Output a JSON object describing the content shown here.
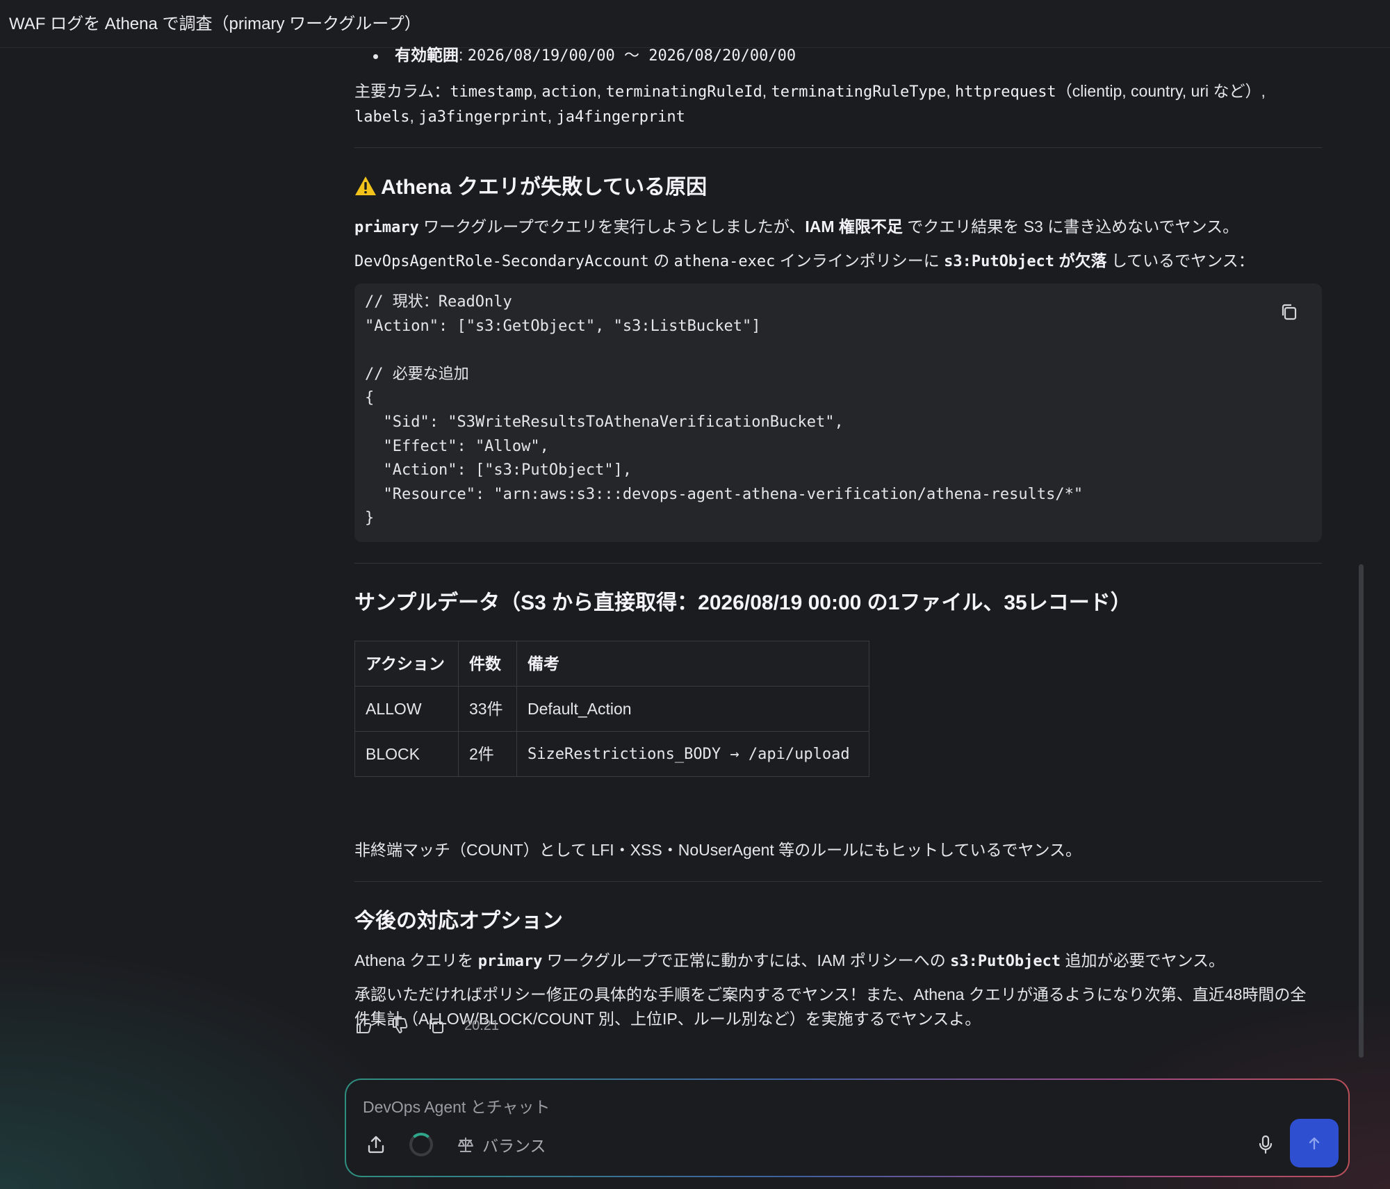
{
  "header": {
    "title": "WAF ログを Athena で調査（primary ワークグループ）"
  },
  "message": {
    "validity_label": "有効範囲",
    "validity_value": "2026/08/19/00/00 〜 2026/08/20/00/00",
    "columns_prefix": "主要カラム：",
    "columns": {
      "c1": "timestamp",
      "c2": "action",
      "c3": "terminatingRuleId",
      "c4": "terminatingRuleType",
      "c5": "httprequest",
      "c5_note": "（clientip, country, uri など）",
      "c6": "labels",
      "c7": "ja3fingerprint",
      "c8": "ja4fingerprint"
    },
    "cause": {
      "heading": "Athena クエリが失敗している原因",
      "p1_code": "primary",
      "p1_a": " ワークグループでクエリを実行しようとしましたが、",
      "p1_bold": "IAM 権限不足",
      "p1_b": " でクエリ結果を S3 に書き込めないでヤンス。",
      "p2_code1": "DevOpsAgentRole-SecondaryAccount",
      "p2_a": " の ",
      "p2_code2": "athena-exec",
      "p2_b": " インラインポリシーに ",
      "p2_code3": "s3:PutObject",
      "p2_bold": " が欠落",
      "p2_c": " しているでヤンス：",
      "code": "// 現状：ReadOnly\n\"Action\": [\"s3:GetObject\", \"s3:ListBucket\"]\n\n// 必要な追加\n{\n  \"Sid\": \"S3WriteResultsToAthenaVerificationBucket\",\n  \"Effect\": \"Allow\",\n  \"Action\": [\"s3:PutObject\"],\n  \"Resource\": \"arn:aws:s3:::devops-agent-athena-verification/athena-results/*\"\n}"
    },
    "sample": {
      "heading": "サンプルデータ（S3 から直接取得：2026/08/19 00:00 の1ファイル、35レコード）",
      "headers": [
        "アクション",
        "件数",
        "備考"
      ],
      "rows": [
        [
          "ALLOW",
          "33件",
          "Default_Action"
        ],
        [
          "BLOCK",
          "2件",
          "SizeRestrictions_BODY → /api/upload"
        ]
      ],
      "note": "非終端マッチ（COUNT）として LFI・XSS・NoUserAgent 等のルールにもヒットしているでヤンス。"
    },
    "options": {
      "heading": "今後の対応オプション",
      "p1_a": "Athena クエリを ",
      "p1_code1": "primary",
      "p1_b": " ワークグループで正常に動かすには、IAM ポリシーへの ",
      "p1_code2": "s3:PutObject",
      "p1_c": " 追加が必要でヤンス。",
      "p2": "承認いただければポリシー修正の具体的な手順をご案内するでヤンス！また、Athena クエリが通るようになり次第、直近48時間の全件集計（ALLOW/BLOCK/COUNT 別、上位IP、ルール別など）を実施するでヤンスよ。"
    },
    "timestamp": "20:21"
  },
  "chat": {
    "placeholder": "DevOps Agent とチャット",
    "mode_label": "バランス"
  },
  "icons": {
    "warning": "warning-icon",
    "copy": "copy-icon",
    "thumbs_up": "thumbs-up-icon",
    "thumbs_down": "thumbs-down-icon",
    "upload": "upload-icon",
    "balance": "balance-scale-icon",
    "mic": "microphone-icon",
    "send": "arrow-up-icon"
  },
  "colors": {
    "send_button": "#2d4fd0",
    "warning": "#f2c31b",
    "spinner_accent": "#2fa58a"
  }
}
